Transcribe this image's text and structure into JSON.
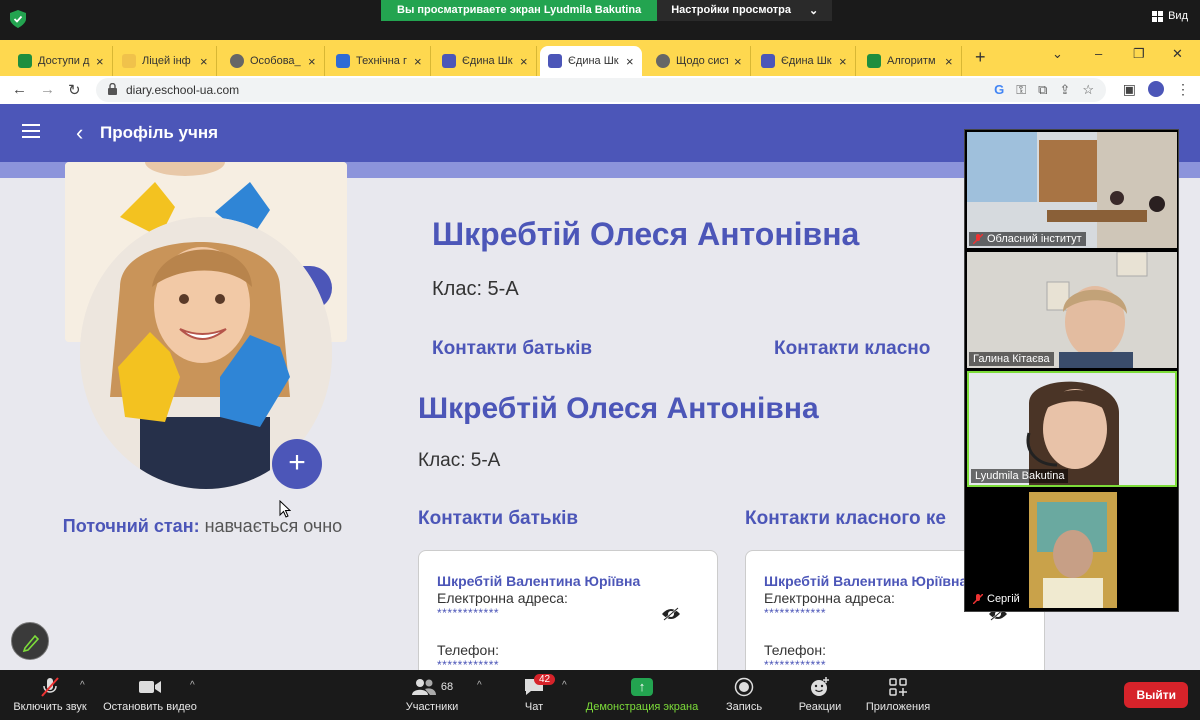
{
  "zoom_top": {
    "share_notice": "Вы просматриваете экран Lyudmila Bakutina",
    "view_options": "Настройки просмотра",
    "view_button": "Вид"
  },
  "tabs": [
    {
      "title": "Доступи д",
      "color": "#1e8e3e"
    },
    {
      "title": "Ліцей інф",
      "color": "#f0c24b"
    },
    {
      "title": "Особова_",
      "color": "#666666"
    },
    {
      "title": "Технічна г",
      "color": "#2f6bd4"
    },
    {
      "title": "Єдина Шк",
      "color": "#4c56b8"
    },
    {
      "title": "Єдина Шк",
      "color": "#4c56b8"
    },
    {
      "title": "Щодо сист",
      "color": "#666666"
    },
    {
      "title": "Єдина Шк",
      "color": "#4c56b8"
    },
    {
      "title": "Алгоритм",
      "color": "#1e8e3e"
    }
  ],
  "address_bar": {
    "url": "diary.eschool-ua.com"
  },
  "page": {
    "title": "Профіль учня",
    "student_name": "Шкребтій Олеся Антонівна",
    "class_label": "Клас: 5-А",
    "status_label": "Поточний стан:",
    "status_value": "навчається очно",
    "contacts_parents": "Контакти батьків",
    "contacts_teacher": "Контакти класного ке",
    "contacts_teacher_ghost": "Контакти класно",
    "cards": [
      {
        "name": "Шкребтій Валентина Юріївна",
        "email_label": "Електронна адреса:",
        "email_value": "************",
        "phone_label": "Телефон:",
        "phone_value": "************"
      },
      {
        "name": "Шкребтій Валентина Юріївна",
        "email_label": "Електронна адреса:",
        "email_value": "************",
        "phone_label": "Телефон:",
        "phone_value": "************"
      }
    ]
  },
  "participants": [
    {
      "name": "Обласний інститут",
      "muted": true
    },
    {
      "name": "Галина Кітаєва",
      "muted": false
    },
    {
      "name": "Lyudmila Bakutina",
      "muted": false
    },
    {
      "name": "Сергій",
      "muted": true
    }
  ],
  "zoom_bottom": {
    "mute": "Включить звук",
    "video": "Остановить видео",
    "participants": "Участники",
    "participants_count": "68",
    "chat": "Чат",
    "chat_badge": "42",
    "share": "Демонстрация экрана",
    "record": "Запись",
    "reactions": "Реакции",
    "apps": "Приложения",
    "leave": "Выйти"
  }
}
